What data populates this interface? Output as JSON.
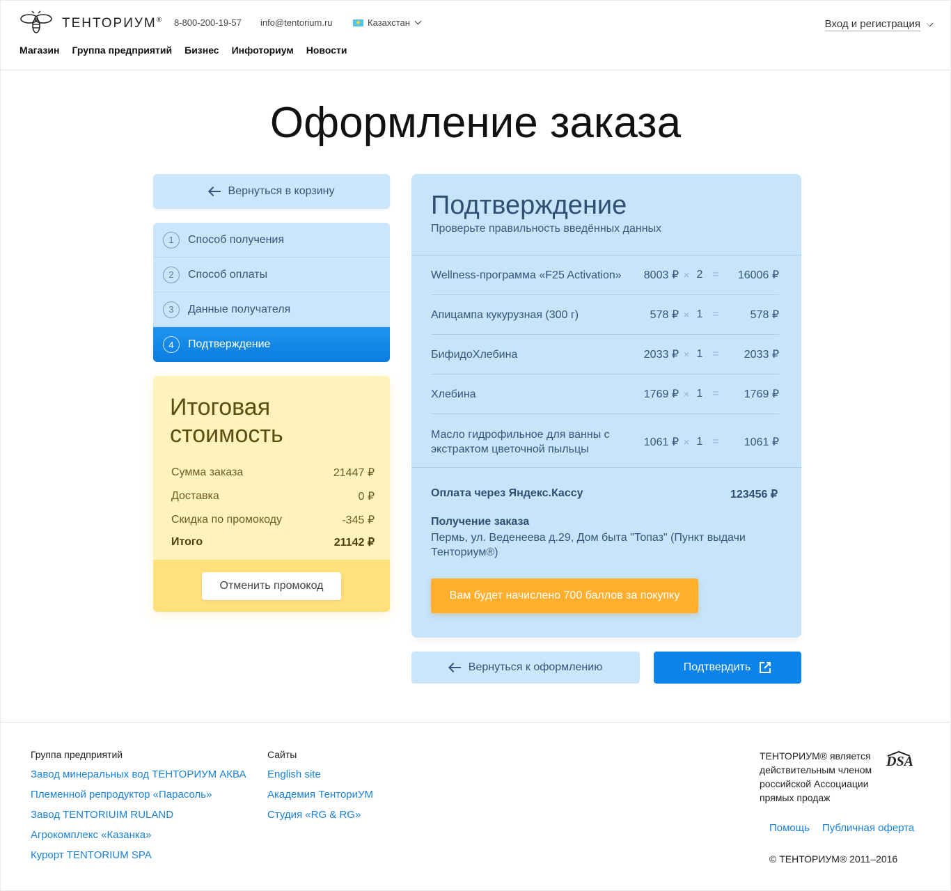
{
  "header": {
    "brand": "ТЕНТОРИУМ",
    "phone": "8-800-200-19-57",
    "email": "info@tentorium.ru",
    "country": "Казахстан",
    "login": "Вход и регистрация",
    "nav": [
      "Магазин",
      "Группа предприятий",
      "Бизнес",
      "Инфоториум",
      "Новости"
    ]
  },
  "page_title": "Оформление заказа",
  "back_to_cart": "Вернуться в корзину",
  "steps": [
    {
      "num": "1",
      "label": "Способ получения"
    },
    {
      "num": "2",
      "label": "Способ оплаты"
    },
    {
      "num": "3",
      "label": "Данные получателя"
    },
    {
      "num": "4",
      "label": "Подтверждение"
    }
  ],
  "summary": {
    "title_line1": "Итоговая",
    "title_line2": "стоимость",
    "rows": [
      {
        "label": "Сумма заказа",
        "value": "21447 ₽"
      },
      {
        "label": "Доставка",
        "value": "0 ₽"
      },
      {
        "label": "Скидка по промокоду",
        "value": "-345 ₽"
      }
    ],
    "total_label": "Итого",
    "total_value": "21142 ₽",
    "cancel_promo": "Отменить промокод"
  },
  "confirmation": {
    "title": "Подтверждение",
    "subtitle": "Проверьте правильность введённых данных",
    "items": [
      {
        "name": "Wellness-программа «F25 Activation»",
        "price": "8003 ₽",
        "qty": "2",
        "sum": "16006 ₽"
      },
      {
        "name": "Апицампа кукурузная (300 г)",
        "price": "578 ₽",
        "qty": "1",
        "sum": "578 ₽"
      },
      {
        "name": "БифидоХлебина",
        "price": "2033 ₽",
        "qty": "1",
        "sum": "2033 ₽"
      },
      {
        "name": "Хлебина",
        "price": "1769 ₽",
        "qty": "1",
        "sum": "1769 ₽"
      },
      {
        "name": "Масло гидрофильное для ванны с экстрактом цветочной пыльцы",
        "price": "1061 ₽",
        "qty": "1",
        "sum": "1061 ₽"
      }
    ],
    "times_sign": "×",
    "equals_sign": "=",
    "payment_label": "Оплата через Яндекс.Кассу",
    "payment_value": "123456 ₽",
    "receive_title": "Получение заказа",
    "receive_address": "Пермь, ул. Веденеева д.29, Дом быта \"Топаз\" (Пункт выдачи Тенториум®)",
    "bonus": "Вам будет начислено 700 баллов за покупку"
  },
  "actions": {
    "back": "Вернуться к оформлению",
    "confirm": "Подтвердить"
  },
  "footer": {
    "col1_title": "Группа предприятий",
    "col1_links": [
      "Завод минеральных вод ТЕНТОРИУМ АКВА",
      "Племенной репродуктор «Парасоль»",
      "Завод TENTORIUIM RULAND",
      "Агрокомплекс «Казанка»",
      "Курорт TENTORIUM SPA"
    ],
    "col2_title": "Сайты",
    "col2_links": [
      "English site",
      "Академия ТенториУМ",
      "Студия «RG & RG»"
    ],
    "dsa_text": "ТЕНТОРИУМ® является действительным членом российской Ассоциации прямых продаж",
    "help": "Помощь",
    "offer": "Публичная оферта",
    "copyright": "© ТЕНТОРИУМ® 2011–2016"
  }
}
